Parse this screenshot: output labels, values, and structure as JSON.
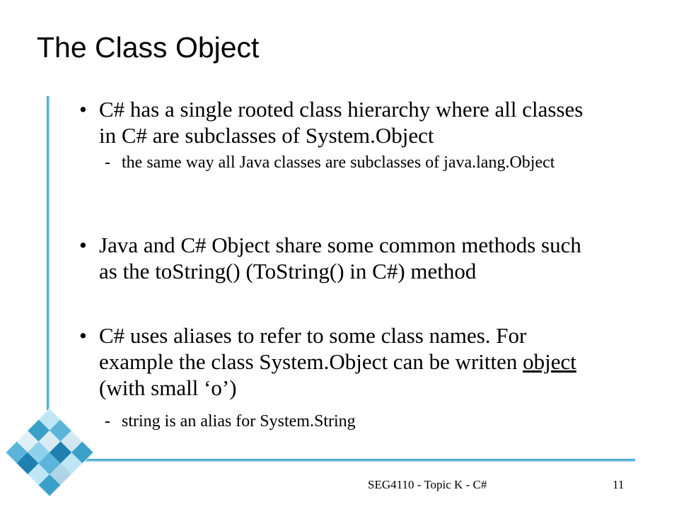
{
  "slide": {
    "title": "The Class Object",
    "bullets": [
      {
        "marker": "•",
        "text": "C# has a single rooted class hierarchy where all classes in C# are subclasses of System.Object",
        "sub": {
          "marker": "-",
          "text": "the same way all Java classes are subclasses of java.lang.Object"
        }
      },
      {
        "marker": "•",
        "text": "Java and C# Object share some common methods such as the toString() (ToString() in C#) method"
      },
      {
        "marker": "•",
        "text_before": "C# uses aliases to refer to some class names. For example the class System.Object can be written ",
        "underlined": "object",
        "text_after": " (with small ‘o’)",
        "sub": {
          "marker": "-",
          "text": "string is an alias for System.String"
        }
      }
    ]
  },
  "footer": {
    "course": "SEG4110 - Topic K - C#",
    "page_number": "11"
  },
  "colors": {
    "accent": "#3aa0c8",
    "accent_light": "#8fd0ea",
    "logo_dark": "#1f7fb0"
  },
  "icons": {
    "logo": "diamond-mosaic-logo"
  }
}
